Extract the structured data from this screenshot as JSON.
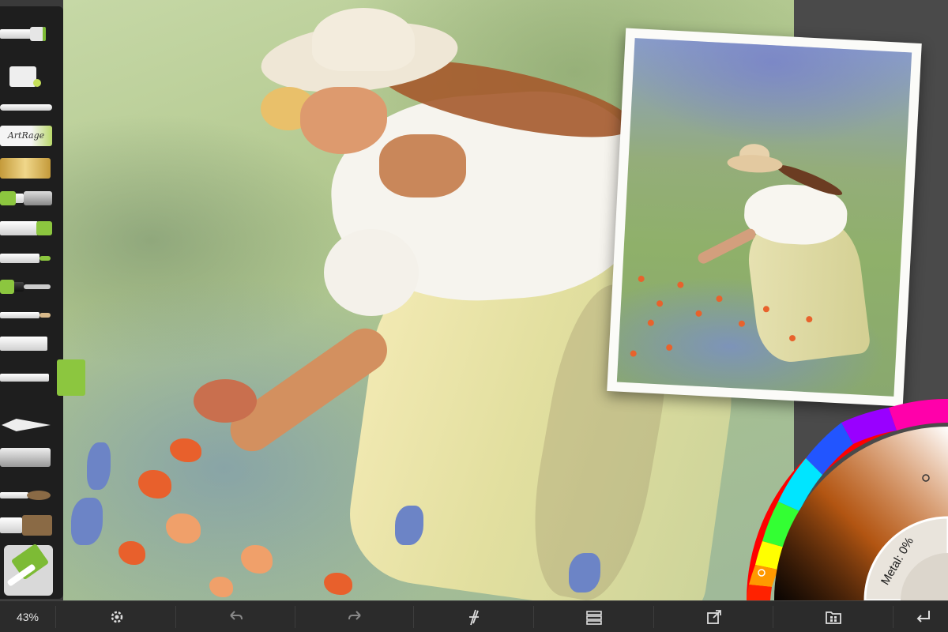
{
  "app": {
    "name": "ArtRage"
  },
  "toolbar_left": {
    "logo_text": "ArtRage",
    "tools": [
      {
        "name": "paint-roller-tool-icon"
      },
      {
        "name": "paint-bucket-tool-icon"
      },
      {
        "name": "palette-knife-tool-icon"
      },
      {
        "name": "artrage-logo"
      },
      {
        "name": "glitter-tube-tool-icon"
      },
      {
        "name": "airbrush-tool-icon"
      },
      {
        "name": "paint-tube-tool-icon"
      },
      {
        "name": "felt-pen-tool-icon"
      },
      {
        "name": "ink-pen-tool-icon"
      },
      {
        "name": "pencil-tool-icon"
      },
      {
        "name": "chalk-tool-icon"
      },
      {
        "name": "roller-tool-icon"
      },
      {
        "name": "eraser-tool-icon"
      },
      {
        "name": "spray-gun-tool-icon"
      },
      {
        "name": "oil-brush-tool-icon"
      },
      {
        "name": "flat-brush-tool-icon"
      }
    ],
    "selected_tool": "roller",
    "current_color": "#7dbb35"
  },
  "color_picker": {
    "metal_label": "Metal: 0%",
    "selected_hue": "#ff7a1a"
  },
  "bottombar": {
    "zoom": "43%",
    "buttons": [
      "settings",
      "undo",
      "redo",
      "tool-settings",
      "layers",
      "share",
      "gallery",
      "back"
    ]
  },
  "colors": {
    "toolbar_bg": "#1e1e1e",
    "bottombar_bg": "#2b2b2b",
    "accent_green": "#7dbb35"
  }
}
